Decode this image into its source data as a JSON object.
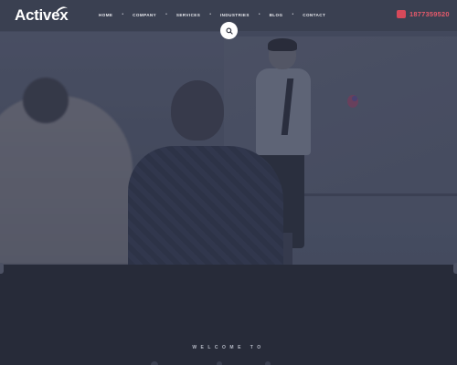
{
  "brand": {
    "name": "Activex"
  },
  "nav": {
    "items": [
      {
        "label": "HOME"
      },
      {
        "label": "COMPANY"
      },
      {
        "label": "SERVICES"
      },
      {
        "label": "INDUSTRIES"
      },
      {
        "label": "BLOG"
      },
      {
        "label": "CONTACT"
      }
    ],
    "separator": "•"
  },
  "header": {
    "phone": "1877359520"
  },
  "search": {
    "icon": "search-icon"
  },
  "hero": {
    "image": "presentation-meeting-photo"
  },
  "welcome": {
    "text": "WELCOME TO"
  },
  "colors": {
    "accent": "#e55a6b",
    "navbar": "#3a4050",
    "page_bg": "#272b39"
  }
}
